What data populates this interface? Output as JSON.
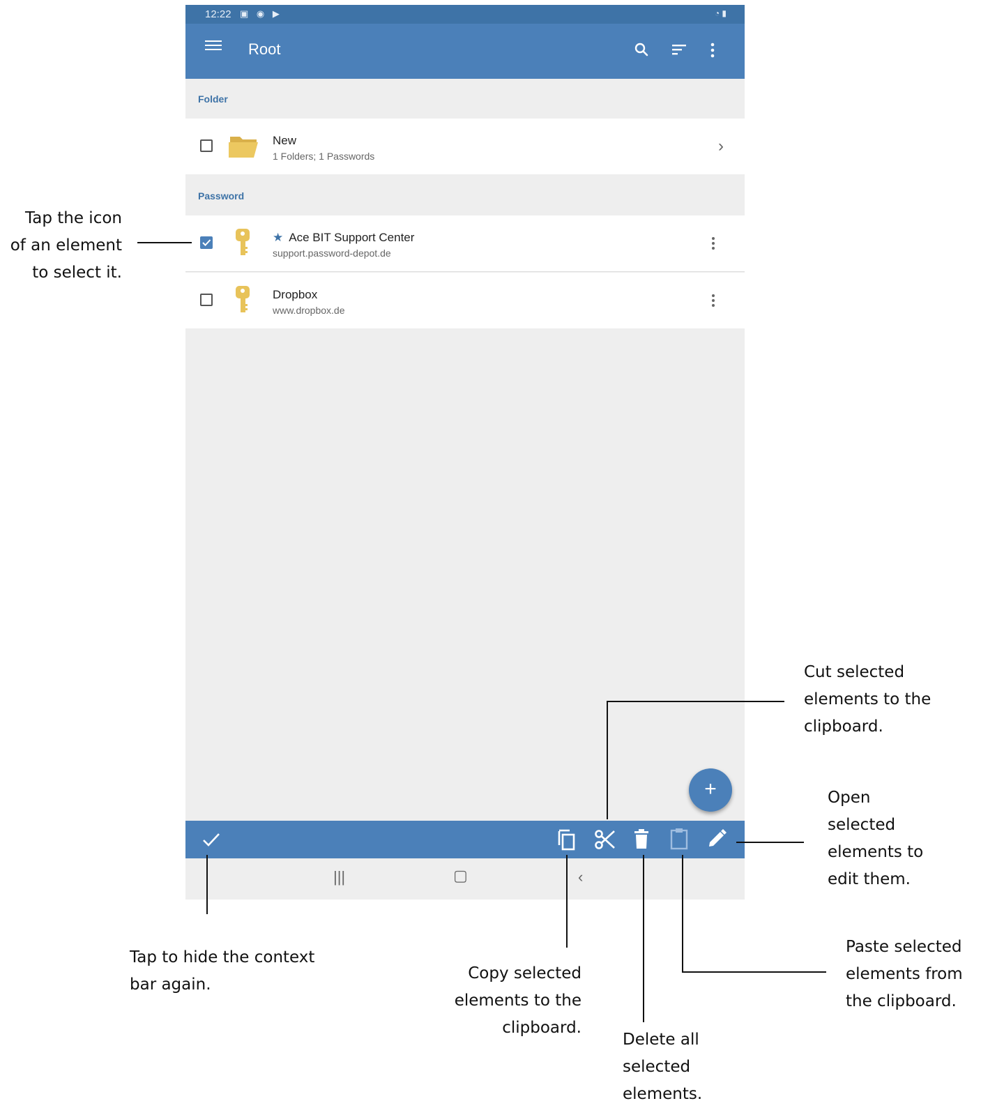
{
  "status_bar": {
    "time": "12:22"
  },
  "app_bar": {
    "title": "Root",
    "icons": [
      "menu-icon",
      "search-icon",
      "sort-icon",
      "more-vert-icon"
    ]
  },
  "sections": {
    "folder_header": "Folder",
    "password_header": "Password"
  },
  "folder_item": {
    "name": "New",
    "details": "1 Folders; 1 Passwords",
    "selected": false
  },
  "password_items": [
    {
      "name": "Ace BIT Support Center",
      "url": "support.password-depot.de",
      "favorite": true,
      "selected": true
    },
    {
      "name": "Dropbox",
      "url": "www.dropbox.de",
      "favorite": false,
      "selected": false
    }
  ],
  "fab": {
    "label": "+"
  },
  "context_bar": {
    "icons": [
      "done-check-icon",
      "copy-icon",
      "cut-scissors-icon",
      "delete-trash-icon",
      "paste-clipboard-icon",
      "edit-pencil-icon"
    ]
  },
  "callouts": {
    "select": "Tap the icon\nof an element\nto select it.",
    "hide": "Tap to hide the context\nbar again.",
    "copy": "Copy selected\nelements to the\nclipboard.",
    "delete": "Delete all\nselected\nelements.",
    "paste": "Paste selected\nelements from\nthe clipboard.",
    "cut": "Cut selected\nelements to the\nclipboard.",
    "edit": "Open\nselected\nelements to\nedit them."
  },
  "colors": {
    "primary": "#4b80b9",
    "status_bar": "#3e73a7",
    "folder_yellow": "#e8c35a",
    "background": "#eeeeee"
  }
}
